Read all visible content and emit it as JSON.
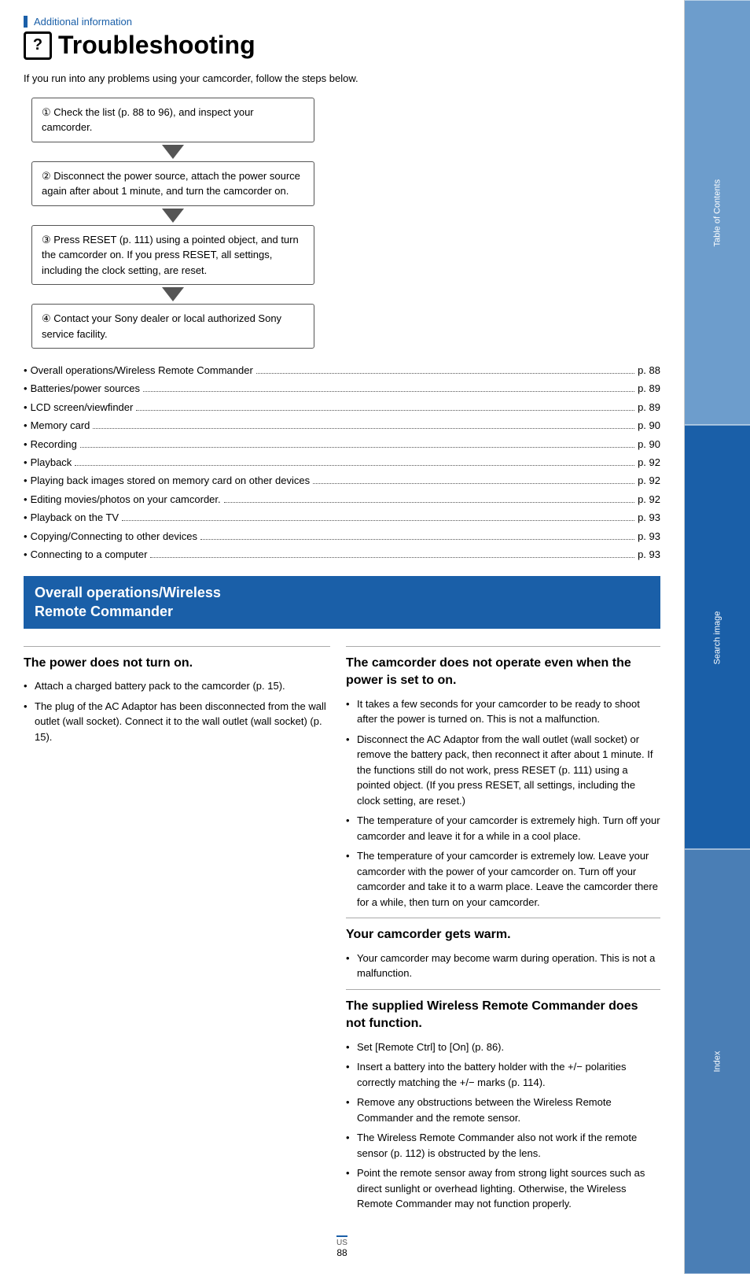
{
  "header": {
    "additional_info": "Additional information",
    "page_title": "Troubleshooting",
    "title_icon": "?",
    "intro": "If you run into any problems using your camcorder, follow the steps below."
  },
  "steps": [
    {
      "num": "1",
      "text": "Check the list (p. 88 to 96), and inspect your camcorder."
    },
    {
      "num": "2",
      "text": "Disconnect the power source, attach the power source again after about 1 minute, and turn the camcorder on."
    },
    {
      "num": "3",
      "text": "Press RESET (p. 111) using a pointed object, and turn the camcorder on. If you press RESET, all settings, including the clock setting, are reset."
    },
    {
      "num": "4",
      "text": "Contact your Sony dealer or local authorized Sony service facility."
    }
  ],
  "toc": {
    "items": [
      {
        "label": "Overall operations/Wireless Remote Commander",
        "page": "p. 88"
      },
      {
        "label": "Batteries/power sources",
        "page": "p. 89"
      },
      {
        "label": "LCD screen/viewfinder",
        "page": "p. 89"
      },
      {
        "label": "Memory card",
        "page": "p. 90"
      },
      {
        "label": "Recording",
        "page": "p. 90"
      },
      {
        "label": "Playback",
        "page": "p. 92"
      },
      {
        "label": "Playing back images stored on memory card on other devices",
        "page": "p. 92"
      },
      {
        "label": "Editing movies/photos on your camcorder.",
        "page": "p. 92"
      },
      {
        "label": "Playback on the TV",
        "page": "p. 93"
      },
      {
        "label": "Copying/Connecting to other devices",
        "page": "p. 93"
      },
      {
        "label": "Connecting to a computer",
        "page": "p. 93"
      }
    ]
  },
  "section_header": "Overall operations/Wireless\nRemote Commander",
  "subsections": {
    "power_does_not_turn_on": {
      "title": "The power does not turn on.",
      "bullets": [
        "Attach a charged battery pack to the camcorder (p. 15).",
        "The plug of the AC Adaptor has been disconnected from the wall outlet (wall socket). Connect it to the wall outlet (wall socket) (p. 15)."
      ]
    },
    "camcorder_not_operate": {
      "title": "The camcorder does not operate even when the power is set to on.",
      "bullets": [
        "It takes a few seconds for your camcorder to be ready to shoot after the power is turned on. This is not a malfunction.",
        "Disconnect the AC Adaptor from the wall outlet (wall socket) or remove the battery pack, then reconnect it after about 1 minute. If the functions still do not work, press RESET (p. 111) using a pointed object. (If you press RESET, all settings, including the clock setting, are reset.)",
        "The temperature of your camcorder is extremely high. Turn off your camcorder and leave it for a while in a cool place.",
        "The temperature of your camcorder is extremely low. Leave your camcorder with the power of your camcorder on. Turn off your camcorder and take it to a warm place. Leave the camcorder there for a while, then turn on your camcorder."
      ]
    },
    "camcorder_gets_warm": {
      "title": "Your camcorder gets warm.",
      "bullets": [
        "Your camcorder may become warm during operation. This is not a malfunction."
      ]
    },
    "wireless_remote": {
      "title": "The supplied Wireless Remote Commander does not function.",
      "bullets": [
        "Set [Remote Ctrl] to [On] (p. 86).",
        "Insert a battery into the battery holder with the +/− polarities correctly matching the +/− marks (p. 114).",
        "Remove any obstructions between the Wireless Remote Commander and the remote sensor.",
        "The Wireless Remote Commander will also not work if the remote sensor (p. 112) is obstructed by the lens.",
        "Point the remote sensor away from strong light sources such as direct sunlight or overhead lighting. Otherwise, the Wireless Remote Commander may not function properly."
      ]
    }
  },
  "sidebar": {
    "tabs": [
      {
        "label": "Table of Contents"
      },
      {
        "label": "Search image"
      },
      {
        "label": "Index"
      }
    ]
  },
  "footer": {
    "country_code": "US",
    "page_number": "88"
  }
}
